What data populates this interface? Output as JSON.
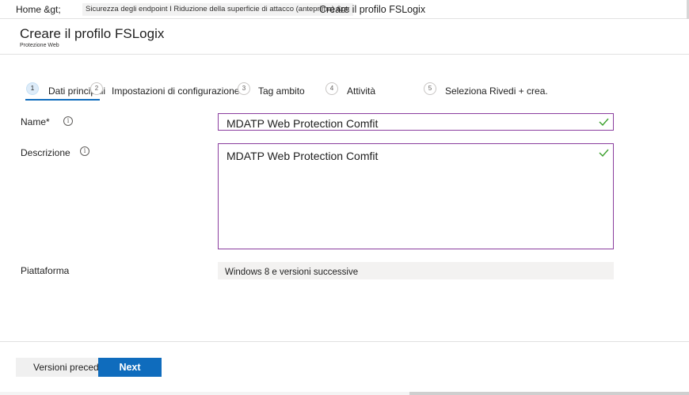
{
  "breadcrumb": {
    "home": "Home &gt;",
    "middle": "Sicurezza degli endpoint I Riduzione della superficie di attacco (anteprima) &gt;",
    "current": "Creare il profilo FSLogix"
  },
  "header": {
    "title": "Creare il profilo FSLogix",
    "subtitle": "Protezione Web"
  },
  "steps": [
    {
      "number": "1",
      "label": "Dati principali",
      "active": true
    },
    {
      "number": "2",
      "label": "Impostazioni di configurazione",
      "active": false
    },
    {
      "number": "3",
      "label": "Tag ambito",
      "active": false
    },
    {
      "number": "4",
      "label": "Attività",
      "active": false
    },
    {
      "number": "5",
      "label": "Seleziona Rivedi + crea.",
      "active": false
    }
  ],
  "form": {
    "name_label": "Name*",
    "name_value": "MDATP Web Protection Comfit",
    "description_label": "Descrizione",
    "description_value": "MDATP Web Protection Comfit",
    "platform_label": "Piattaforma",
    "platform_value": "Windows 8 e versioni successive",
    "info_icon": "i"
  },
  "footer": {
    "back_label": "Versioni precedenti",
    "next_label": "Next"
  },
  "colors": {
    "accent": "#0f6cbd",
    "input_border": "#8a3d9e",
    "valid_check": "#3a9f2b"
  }
}
